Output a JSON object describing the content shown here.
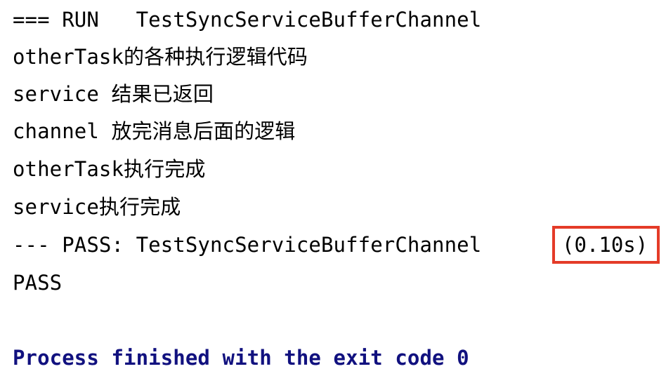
{
  "console": {
    "background_color": "#FFFFFF",
    "default_text_color": "#000000",
    "highlight_box_color": "#E43B28",
    "exit_line_color": "#11117F",
    "lines": [
      {
        "text": "=== RUN   TestSyncServiceBufferChannel"
      },
      {
        "text": "otherTask的各种执行逻辑代码"
      },
      {
        "text": "service 结果已返回"
      },
      {
        "text": "channel 放完消息后面的逻辑"
      },
      {
        "text": "otherTask执行完成"
      },
      {
        "text": "service执行完成"
      },
      {
        "text": "--- PASS: TestSyncServiceBufferChannel"
      },
      {
        "text": "PASS"
      },
      {
        "text": ""
      },
      {
        "text": "Process finished with the exit code 0"
      }
    ],
    "duration_badge": {
      "label": "(0.10s)",
      "seconds": "0.10",
      "border_color": "#E43B28"
    }
  }
}
